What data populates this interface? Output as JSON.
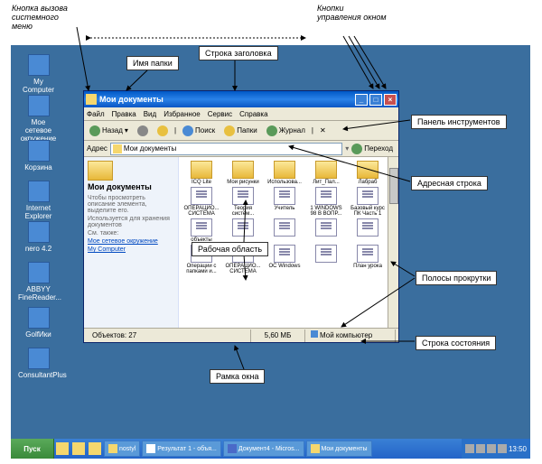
{
  "annotations": {
    "systemMenu": "Кнопка вызова системного меню",
    "folderName": "Имя папки",
    "titleBar": "Строка заголовка",
    "windowButtons": "Кнопки управления окном",
    "toolPanel": "Панель инструментов",
    "addressBar": "Адресная строка",
    "workArea": "Рабочая область",
    "scrollBars": "Полосы прокрутки",
    "statusLine": "Строка состояния",
    "windowFrame": "Рамка окна"
  },
  "window": {
    "title": "Мои документы",
    "menu": {
      "file": "Файл",
      "edit": "Правка",
      "view": "Вид",
      "fav": "Избранное",
      "tools": "Сервис",
      "help": "Справка"
    },
    "toolbar": {
      "back": "Назад",
      "search": "Поиск",
      "folders": "Папки",
      "journal": "Журнал"
    },
    "addressLabel": "Адрес",
    "addressValue": "Мои документы",
    "goLabel": "Переход",
    "leftPanel": {
      "heading": "Мои документы",
      "tip": "Чтобы просмотреть описание элемента, выделите его.",
      "desc": "Используется для хранения документов",
      "also": "См. также:",
      "link1": "Мое сетевое окружение",
      "link2": "My Computer"
    },
    "files": {
      "f1": "ICQ Lite",
      "f2": "Мои рисунки",
      "f3": "Использова...",
      "f4": "Лит_Пал...",
      "f5": "Лабраб",
      "f6": "ОПЕРАЦИО... СИСТЕМА",
      "f7": "Теория систем...",
      "f8": "Учитель",
      "f9": "1 WINDOWS 98 В ВОПР...",
      "f10": "Базовый курс ПК Часть 1",
      "f11": "объекты",
      "f12": "",
      "f13": "",
      "f14": "",
      "f15": "",
      "f16": "Операции с папками и...",
      "f17": "ОПЕРАЦИО... СИСТЕМА",
      "f18": "ОС Windows",
      "f19": "",
      "f20": "План урока"
    },
    "status": {
      "objects": "Объектов: 27",
      "size": "5,60 МБ",
      "location": "Мой компьютер"
    }
  },
  "desktop": {
    "icons": {
      "i1": "My Computer",
      "i2": "Мое сетевое окружение",
      "i3": "Корзина",
      "i4": "Internet Explorer",
      "i5": "nero 4.2",
      "i6": "ABBYY FineReader...",
      "i7": "GolfИки",
      "i8": "ConsultantPlus"
    }
  },
  "taskbar": {
    "start": "Пуск",
    "tasks": {
      "t1": "nostyl",
      "t2": "Результат 1 - объя...",
      "t3": "Документ4 - Micros...",
      "t4": "Мои документы"
    },
    "time": "13:50"
  }
}
